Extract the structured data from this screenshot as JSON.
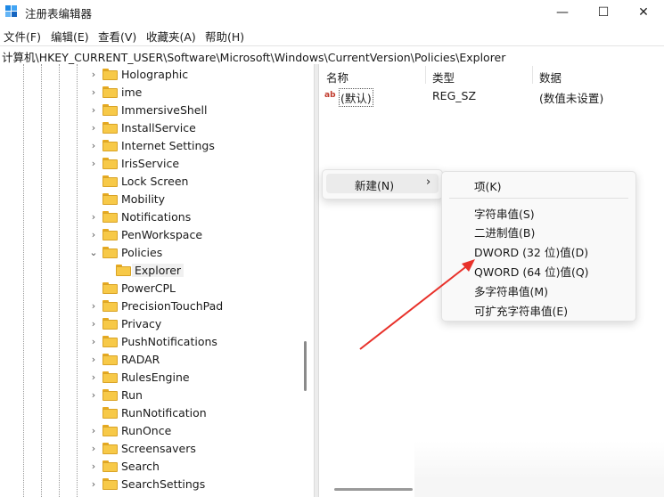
{
  "window": {
    "title": "注册表编辑器",
    "controls": {
      "minimize": "—",
      "maximize": "☐",
      "close": "✕"
    }
  },
  "menubar": [
    "文件(F)",
    "编辑(E)",
    "查看(V)",
    "收藏夹(A)",
    "帮助(H)"
  ],
  "address": "计算机\\HKEY_CURRENT_USER\\Software\\Microsoft\\Windows\\CurrentVersion\\Policies\\Explorer",
  "tree": {
    "nodes": [
      {
        "label": "Holographic",
        "expander": "›"
      },
      {
        "label": "ime",
        "expander": "›"
      },
      {
        "label": "ImmersiveShell",
        "expander": "›"
      },
      {
        "label": "InstallService",
        "expander": "›"
      },
      {
        "label": "Internet Settings",
        "expander": "›"
      },
      {
        "label": "IrisService",
        "expander": "›"
      },
      {
        "label": "Lock Screen",
        "expander": ""
      },
      {
        "label": "Mobility",
        "expander": ""
      },
      {
        "label": "Notifications",
        "expander": "›"
      },
      {
        "label": "PenWorkspace",
        "expander": "›"
      },
      {
        "label": "Policies",
        "expander": "⌄"
      },
      {
        "label": "Explorer",
        "expander": "",
        "child": true,
        "selected": true
      },
      {
        "label": "PowerCPL",
        "expander": ""
      },
      {
        "label": "PrecisionTouchPad",
        "expander": "›"
      },
      {
        "label": "Privacy",
        "expander": "›"
      },
      {
        "label": "PushNotifications",
        "expander": "›"
      },
      {
        "label": "RADAR",
        "expander": "›"
      },
      {
        "label": "RulesEngine",
        "expander": "›"
      },
      {
        "label": "Run",
        "expander": "›"
      },
      {
        "label": "RunNotification",
        "expander": ""
      },
      {
        "label": "RunOnce",
        "expander": "›"
      },
      {
        "label": "Screensavers",
        "expander": "›"
      },
      {
        "label": "Search",
        "expander": "›"
      },
      {
        "label": "SearchSettings",
        "expander": "›"
      }
    ]
  },
  "list": {
    "columns": [
      "名称",
      "类型",
      "数据"
    ],
    "rows": [
      {
        "icon": "ab",
        "name": "(默认)",
        "type": "REG_SZ",
        "data": "(数值未设置)"
      }
    ]
  },
  "context_menu": {
    "new_item": {
      "label": "新建(N)",
      "arrow": "›"
    }
  },
  "submenu": {
    "items": [
      "项(K)",
      "字符串值(S)",
      "二进制值(B)",
      "DWORD (32 位)值(D)",
      "QWORD (64 位)值(Q)",
      "多字符串值(M)",
      "可扩充字符串值(E)"
    ]
  },
  "colors": {
    "annotation_arrow": "#e8312a",
    "folder": "#f7c948"
  }
}
